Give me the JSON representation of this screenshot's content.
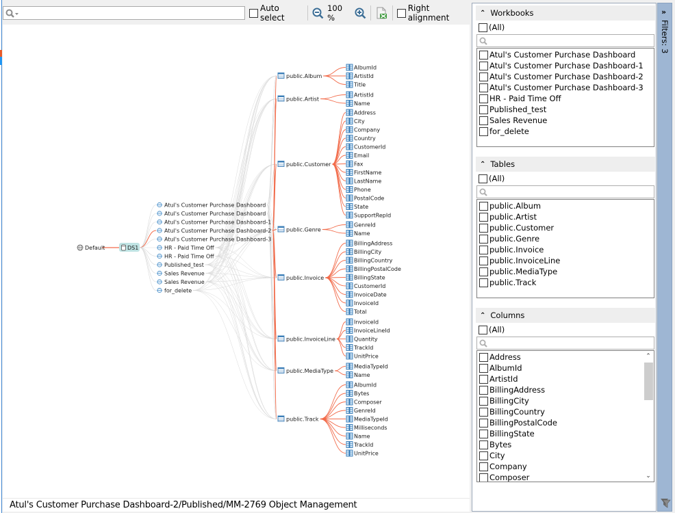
{
  "toolbar": {
    "search_placeholder": "",
    "auto_select_label": "Auto select",
    "zoom_level": "100 %",
    "right_alignment_label": "Right alignment"
  },
  "graph": {
    "root": {
      "label": "Default",
      "icon": "globe-icon"
    },
    "datasource": {
      "label": "DS1",
      "icon": "database-icon"
    },
    "workbooks": [
      {
        "label": "Atul's Customer Purchase Dashboard",
        "highlighted": false
      },
      {
        "label": "Atul's Customer Purchase Dashboard",
        "highlighted": false
      },
      {
        "label": "Atul's Customer Purchase Dashboard-1",
        "highlighted": false
      },
      {
        "label": "Atul's Customer Purchase Dashboard-2",
        "highlighted": true
      },
      {
        "label": "Atul's Customer Purchase Dashboard-3",
        "highlighted": false
      },
      {
        "label": "HR - Paid Time Off",
        "highlighted": false
      },
      {
        "label": "HR - Paid Time Off",
        "highlighted": false
      },
      {
        "label": "Published_test",
        "highlighted": false
      },
      {
        "label": "Sales Revenue",
        "highlighted": false
      },
      {
        "label": "Sales Revenue",
        "highlighted": false
      },
      {
        "label": "for_delete",
        "highlighted": false
      }
    ],
    "tables": [
      {
        "label": "public.Album",
        "columns": [
          "AlbumId",
          "ArtistId",
          "Title"
        ]
      },
      {
        "label": "public.Artist",
        "columns": [
          "ArtistId",
          "Name"
        ]
      },
      {
        "label": "public.Customer",
        "columns": [
          "Address",
          "City",
          "Company",
          "Country",
          "CustomerId",
          "Email",
          "Fax",
          "FirstName",
          "LastName",
          "Phone",
          "PostalCode",
          "State",
          "SupportRepId"
        ]
      },
      {
        "label": "public.Genre",
        "columns": [
          "GenreId",
          "Name"
        ]
      },
      {
        "label": "public.Invoice",
        "columns": [
          "BillingAddress",
          "BillingCity",
          "BillingCountry",
          "BillingPostalCode",
          "BillingState",
          "CustomerId",
          "InvoiceDate",
          "InvoiceId",
          "Total"
        ]
      },
      {
        "label": "public.InvoiceLine",
        "columns": [
          "InvoiceId",
          "InvoiceLineId",
          "Quantity",
          "TrackId",
          "UnitPrice"
        ]
      },
      {
        "label": "public.MediaType",
        "columns": [
          "MediaTypeId",
          "Name"
        ]
      },
      {
        "label": "public.Track",
        "columns": [
          "AlbumId",
          "Bytes",
          "Composer",
          "GenreId",
          "MediaTypeId",
          "Milliseconds",
          "Name",
          "TrackId",
          "UnitPrice"
        ]
      }
    ],
    "colors": {
      "highlight": "#f26b4a",
      "dim": "#d9d9d9"
    }
  },
  "status": {
    "path": "Atul's Customer Purchase Dashboard-2/Published/MM-2769 Object Management"
  },
  "filters": {
    "tab_label": "Filters: 3",
    "workbooks": {
      "title": "Workbooks",
      "all_label": "(All)",
      "items": [
        "Atul's Customer Purchase Dashboard",
        "Atul's Customer Purchase Dashboard-1",
        "Atul's Customer Purchase Dashboard-2",
        "Atul's Customer Purchase Dashboard-3",
        "HR - Paid Time Off",
        "Published_test",
        "Sales Revenue",
        "for_delete"
      ]
    },
    "tables": {
      "title": "Tables",
      "all_label": "(All)",
      "items": [
        "public.Album",
        "public.Artist",
        "public.Customer",
        "public.Genre",
        "public.Invoice",
        "public.InvoiceLine",
        "public.MediaType",
        "public.Track"
      ]
    },
    "columns": {
      "title": "Columns",
      "all_label": "(All)",
      "items": [
        "Address",
        "AlbumId",
        "ArtistId",
        "BillingAddress",
        "BillingCity",
        "BillingCountry",
        "BillingPostalCode",
        "BillingState",
        "Bytes",
        "City",
        "Company",
        "Composer"
      ]
    }
  }
}
